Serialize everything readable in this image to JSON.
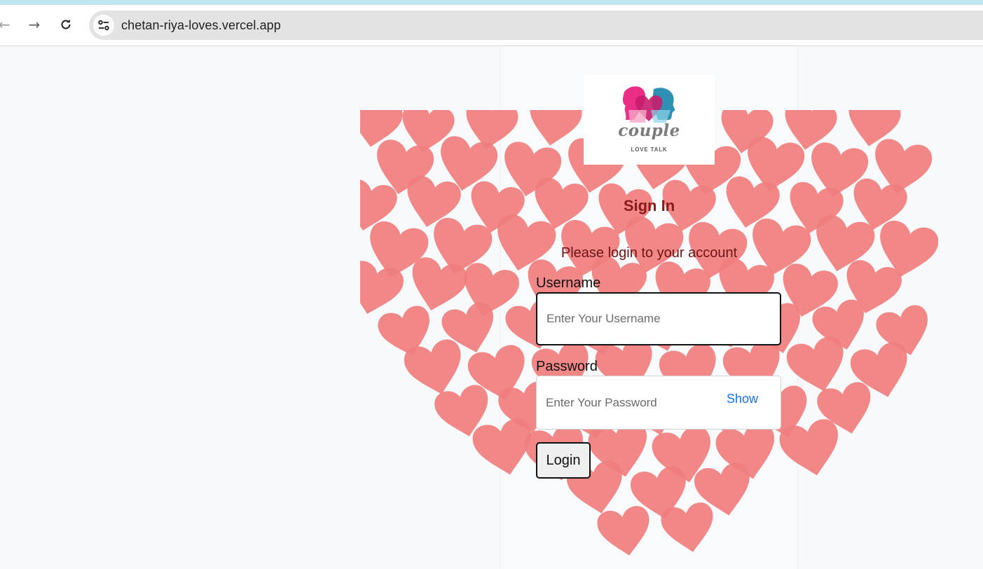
{
  "browser": {
    "url": "chetan-riya-loves.vercel.app",
    "icons": {
      "back": "arrow-left-icon",
      "forward": "arrow-right-icon",
      "reload": "reload-icon",
      "site_info": "tune-icon"
    }
  },
  "logo": {
    "word": "couple",
    "tagline": "LOVE TALK"
  },
  "signin": {
    "title": "Sign In",
    "subtitle": "Please login to your account",
    "username_label": "Username",
    "username_placeholder": "Enter Your Username",
    "password_label": "Password",
    "password_placeholder": "Enter Your Password",
    "show_label": "Show",
    "login_label": "Login"
  },
  "colors": {
    "heart": "#f07d7d",
    "accent_strip": "#bfe7f1",
    "title": "#8c1a1a",
    "link": "#1a73e8"
  }
}
